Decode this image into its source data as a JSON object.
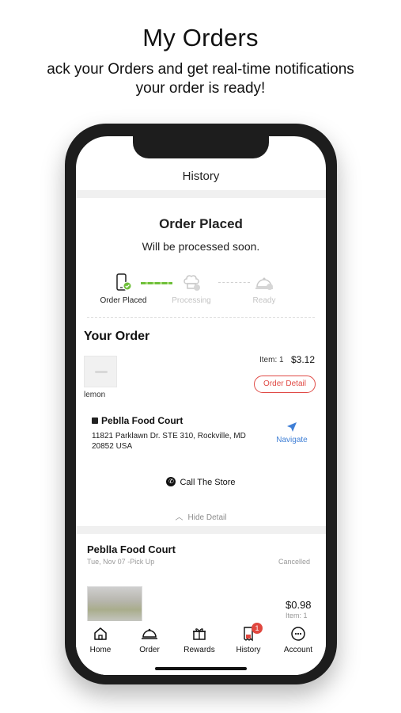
{
  "promo": {
    "title": "My Orders",
    "subtitle_line1": "ack your Orders and get real-time notifications",
    "subtitle_line2": "your order is ready!"
  },
  "header": {
    "title": "History"
  },
  "status": {
    "title": "Order Placed",
    "subtitle": "Will be processed soon.",
    "steps": [
      {
        "label": "Order Placed",
        "icon": "phone-order-icon",
        "active": true
      },
      {
        "label": "Processing",
        "icon": "chef-hat-icon",
        "active": false
      },
      {
        "label": "Ready",
        "icon": "cloche-icon",
        "active": false
      }
    ]
  },
  "current_order": {
    "section_title": "Your Order",
    "item": {
      "name": "lemon",
      "count_label": "Item: 1",
      "price": "$3.12"
    },
    "order_detail_label": "Order Detail",
    "store": {
      "name": "Peblla Food Court",
      "address": "11821 Parklawn Dr. STE 310, Rockville, MD 20852 USA",
      "navigate_label": "Navigate"
    },
    "call_label": "Call The Store",
    "hide_detail_label": "Hide Detail"
  },
  "past_order": {
    "store_name": "Peblla Food Court",
    "date": "Tue, Nov 07 -Pick Up",
    "status": "Cancelled",
    "price": "$0.98",
    "count_label": "Item: 1"
  },
  "tabbar": {
    "items": [
      {
        "label": "Home",
        "icon": "home-icon"
      },
      {
        "label": "Order",
        "icon": "cloche-icon"
      },
      {
        "label": "Rewards",
        "icon": "gift-icon"
      },
      {
        "label": "History",
        "icon": "receipt-icon",
        "badge": "1"
      },
      {
        "label": "Account",
        "icon": "account-icon"
      }
    ]
  },
  "colors": {
    "accent_red": "#e04a45",
    "navigate_blue": "#3f7fd6",
    "progress_green": "#6fbf3a",
    "phone_frame": "#1d1d1d"
  }
}
